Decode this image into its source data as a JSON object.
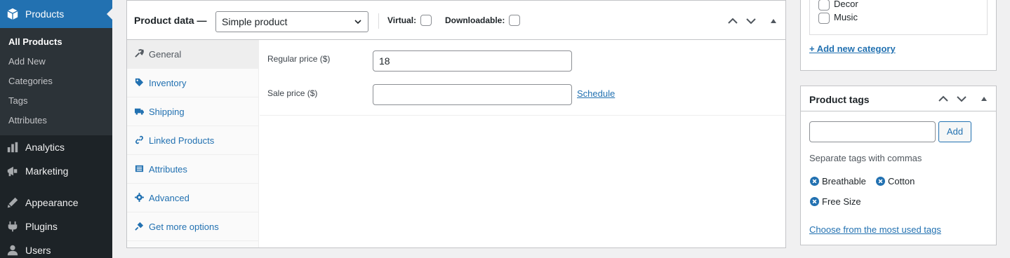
{
  "sidebar": {
    "products_label": "Products",
    "submenu": [
      "All Products",
      "Add New",
      "Categories",
      "Tags",
      "Attributes"
    ],
    "items": [
      {
        "label": "Analytics",
        "icon": "analytics-icon"
      },
      {
        "label": "Marketing",
        "icon": "marketing-icon"
      },
      {
        "label": "Appearance",
        "icon": "appearance-icon"
      },
      {
        "label": "Plugins",
        "icon": "plugins-icon"
      },
      {
        "label": "Users",
        "icon": "users-icon"
      }
    ]
  },
  "product_data": {
    "title": "Product data —",
    "type_selected": "Simple product",
    "virtual_label": "Virtual:",
    "downloadable_label": "Downloadable:",
    "tabs": [
      {
        "label": "General",
        "icon": "wrench-icon"
      },
      {
        "label": "Inventory",
        "icon": "tag-icon"
      },
      {
        "label": "Shipping",
        "icon": "truck-icon"
      },
      {
        "label": "Linked Products",
        "icon": "link-icon"
      },
      {
        "label": "Attributes",
        "icon": "list-icon"
      },
      {
        "label": "Advanced",
        "icon": "gear-icon"
      },
      {
        "label": "Get more options",
        "icon": "plugin-icon"
      }
    ],
    "regular_price_label": "Regular price ($)",
    "regular_price_value": "18",
    "sale_price_label": "Sale price ($)",
    "sale_price_value": "",
    "schedule_link": "Schedule"
  },
  "categories": {
    "items": [
      "Decor",
      "Music"
    ],
    "add_new_link": "+ Add new category"
  },
  "tags": {
    "title": "Product tags",
    "add_button": "Add",
    "help_text": "Separate tags with commas",
    "chips": [
      "Breathable",
      "Cotton",
      "Free Size"
    ],
    "most_used_link": "Choose from the most used tags"
  },
  "colors": {
    "sidebar_bg": "#1d2327",
    "accent": "#2271b1",
    "link": "#2271b1"
  }
}
